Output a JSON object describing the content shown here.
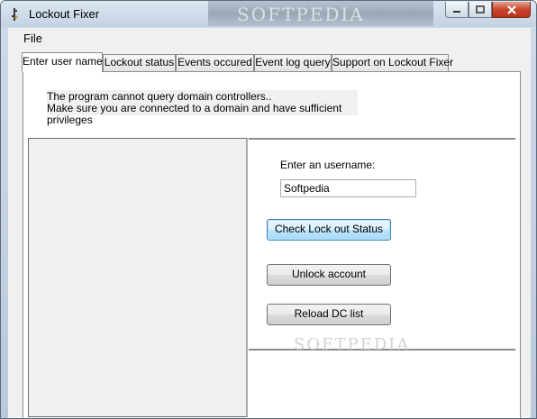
{
  "window": {
    "title": "Lockout Fixer",
    "watermark": "SOFTPEDIA"
  },
  "menu": {
    "file": "File"
  },
  "tabs": [
    {
      "label": "Enter user name",
      "active": true
    },
    {
      "label": "Lockout status",
      "active": false
    },
    {
      "label": "Events occured",
      "active": false
    },
    {
      "label": "Event log query",
      "active": false
    },
    {
      "label": "Support on Lockout Fixer",
      "active": false
    }
  ],
  "message": {
    "line1": "The program cannot query domain controllers..",
    "line2": "Make sure you are connected to a domain and have sufficient privileges"
  },
  "form": {
    "username_label": "Enter an username:",
    "username_value": "Softpedia",
    "check_button": "Check Lock out Status",
    "unlock_button": "Unlock account",
    "reload_button": "Reload DC list"
  },
  "content_watermark": "SOFTPEDIA",
  "colors": {
    "close_button": "#c8452c",
    "focused_button_border": "#3c7fb1",
    "panel_bg": "#f0f0f0"
  }
}
